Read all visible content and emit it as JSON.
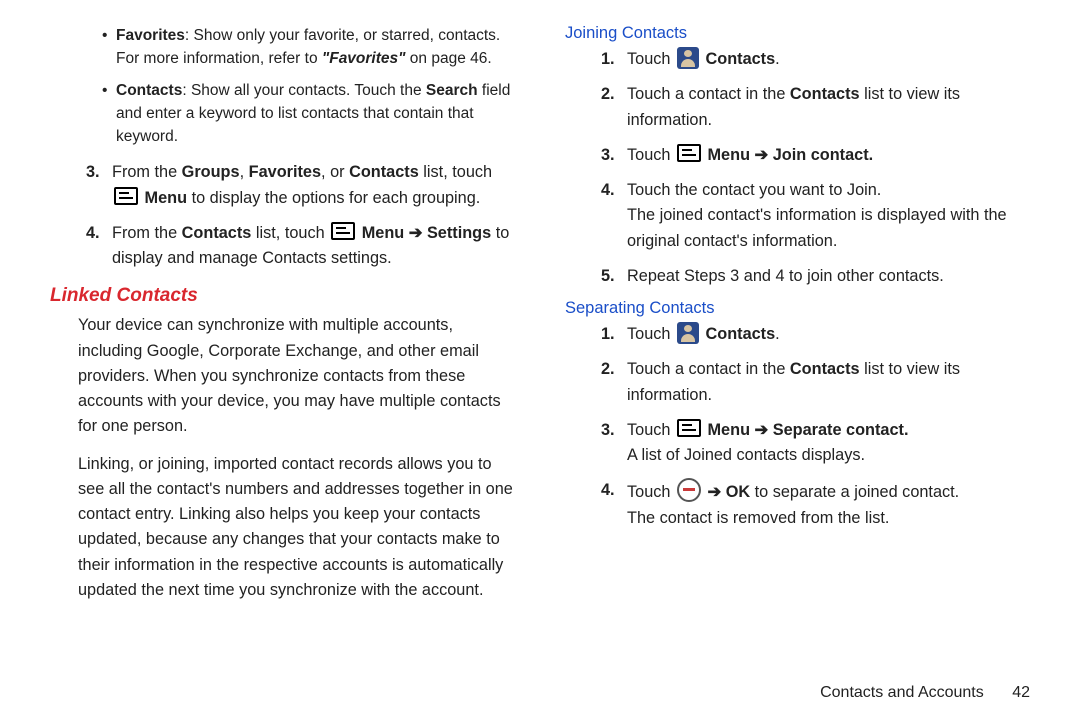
{
  "left": {
    "bullets": [
      {
        "bold": "Favorites",
        "rest": ": Show only your favorite, or starred, contacts. For more information, refer to ",
        "ital": "\"Favorites\"",
        "tail": " on page 46."
      },
      {
        "bold": "Contacts",
        "rest": ": Show all your contacts. Touch the ",
        "bold2": "Search",
        "tail": " field and enter a keyword to list contacts that contain that keyword."
      }
    ],
    "step3": {
      "num": "3.",
      "pre": "From the ",
      "g": "Groups",
      "f": "Favorites",
      "c": "Contacts",
      "mid": " list, touch ",
      "menuWord": "Menu",
      "post": " to display the options for each grouping."
    },
    "step4": {
      "num": "4.",
      "pre": "From the ",
      "c": "Contacts",
      "mid": " list, touch ",
      "menuWord": "Menu",
      "arrow": "➔",
      "settings": "Settings",
      "post": " to display and manage Contacts settings."
    },
    "heading": "Linked Contacts",
    "para1": "Your device can synchronize with multiple accounts, including Google, Corporate Exchange, and other email providers. When you synchronize contacts from these accounts with your device, you may have multiple contacts for one person.",
    "para2": "Linking, or joining, imported contact records allows you to see all the contact's numbers and addresses together in one contact entry. Linking also helps you keep your contacts updated, because any changes that your contacts make to their information in the respective accounts is automatically updated the next time you synchronize with the account."
  },
  "right": {
    "joinHeading": "Joining Contacts",
    "join": {
      "s1": {
        "num": "1.",
        "touch": "Touch ",
        "contacts": "Contacts",
        "dot": "."
      },
      "s2": {
        "num": "2.",
        "pre": "Touch a contact in the ",
        "contacts": "Contacts",
        "post": " list to view its information."
      },
      "s3": {
        "num": "3.",
        "touch": "Touch ",
        "menuWord": "Menu",
        "arrow": "➔",
        "joinC": "Join contact."
      },
      "s4": {
        "num": "4.",
        "line1": "Touch the contact you want to Join.",
        "line2": "The joined contact's information is displayed with the original contact's information."
      },
      "s5": {
        "num": "5.",
        "text": "Repeat Steps 3 and 4 to join other contacts."
      }
    },
    "sepHeading": "Separating Contacts",
    "sep": {
      "s1": {
        "num": "1.",
        "touch": "Touch ",
        "contacts": "Contacts",
        "dot": "."
      },
      "s2": {
        "num": "2.",
        "pre": "Touch a contact in the ",
        "contacts": "Contacts",
        "post": " list to view its information."
      },
      "s3": {
        "num": "3.",
        "touch": "Touch ",
        "menuWord": "Menu",
        "arrow": "➔",
        "sepC": "Separate contact.",
        "post": "A list of Joined contacts displays."
      },
      "s4": {
        "num": "4.",
        "touch": "Touch ",
        "arrow": "➔",
        "ok": "OK",
        "post": " to separate a joined contact.",
        "line2": "The contact is removed from the list."
      }
    }
  },
  "footer": {
    "section": "Contacts and Accounts",
    "page": "42"
  }
}
